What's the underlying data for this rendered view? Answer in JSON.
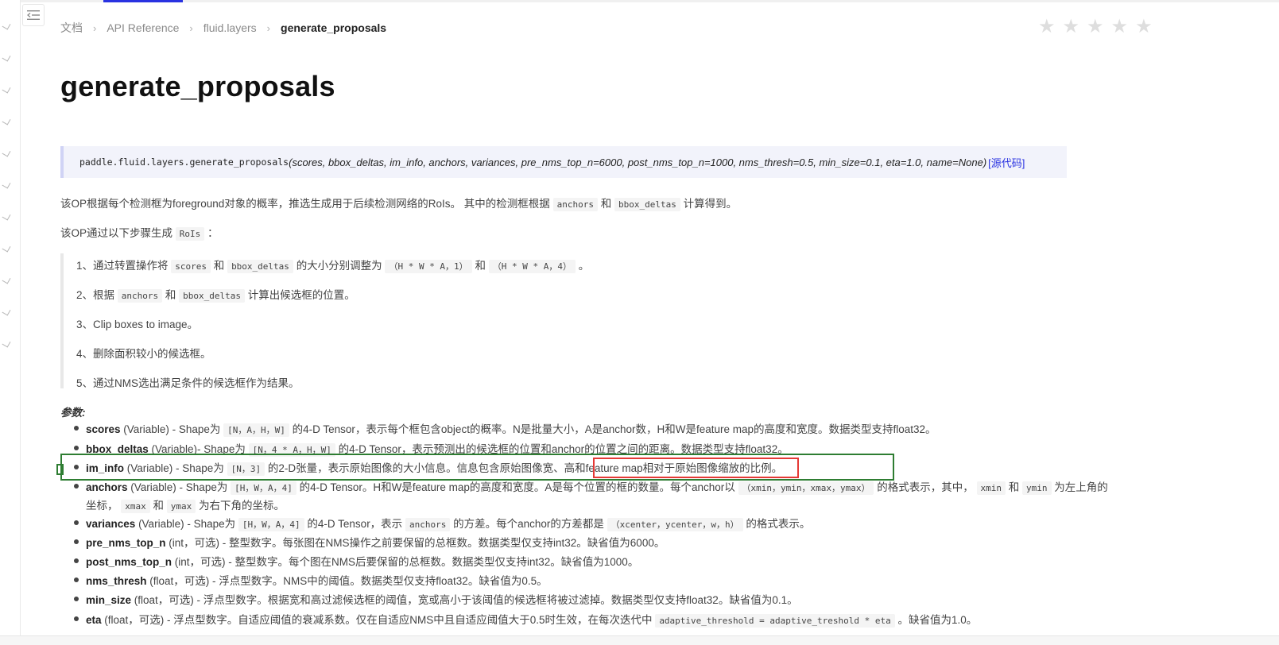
{
  "breadcrumb": {
    "items": [
      "文档",
      "API Reference",
      "fluid.layers"
    ],
    "current": "generate_proposals"
  },
  "rating": {
    "stars": 5,
    "filled": 0
  },
  "title": "generate_proposals",
  "signature": {
    "fn": "paddle.fluid.layers.generate_proposals",
    "args": "(scores, bbox_deltas, im_info, anchors, variances, pre_nms_top_n=6000, post_nms_top_n=1000, nms_thresh=0.5, min_size=0.1, eta=1.0, name=None)",
    "source_link": "[源代码]"
  },
  "intro": {
    "p1_a": "该OP根据每个检测框为foreground对象的概率，推选生成用于后续检测网络的RoIs。 其中的检测框根据",
    "p1_code1": "anchors",
    "p1_mid": "和",
    "p1_code2": "bbox_deltas",
    "p1_b": "计算得到。",
    "p2_a": "该OP通过以下步骤生成",
    "p2_code": "RoIs",
    "p2_b": "："
  },
  "steps": {
    "s1_a": "1、通过转置操作将",
    "s1_c1": "scores",
    "s1_and": "和",
    "s1_c2": "bbox_deltas",
    "s1_b": "的大小分别调整为",
    "s1_c3": "（H * W * A，1）",
    "s1_and2": "和",
    "s1_c4": "（H * W * A，4）",
    "s1_end": "。",
    "s2_a": "2、根据",
    "s2_c1": "anchors",
    "s2_and": "和",
    "s2_c2": "bbox_deltas",
    "s2_b": "计算出候选框的位置。",
    "s3": "3、Clip boxes to image。",
    "s4": "4、删除面积较小的候选框。",
    "s5": "5、通过NMS选出满足条件的候选框作为结果。"
  },
  "params_label": "参数:",
  "params": {
    "scores": {
      "name": "scores",
      "a": " (Variable) - Shape为",
      "code": "[N，A，H，W]",
      "b": "的4-D Tensor，表示每个框包含object的概率。N是批量大小，A是anchor数，H和W是feature map的高度和宽度。数据类型支持float32。"
    },
    "bbox_deltas": {
      "name": "bbox_deltas",
      "a": " (Variable)- Shape为",
      "code": "[N，4 * A，H，W]",
      "b": "的4-D Tensor，表示预测出的候选框的位置和anchor的位置之间的距离。数据类型支持float32。"
    },
    "im_info": {
      "name": "im_info",
      "a": " (Variable) - Shape为",
      "code": "[N，3]",
      "b": "的2-D张量，表示原始图像的大小信息。信息包含原始图像宽、高和feature map相对于原始图像缩放的比例。"
    },
    "anchors": {
      "name": "anchors",
      "a": " (Variable) - Shape为",
      "code": "[H，W，A，4]",
      "b": "的4-D Tensor。H和W是feature map的高度和宽度。A是每个位置的框的数量。每个anchor以",
      "code2": "（xmin，ymin，xmax，ymax）",
      "c": "的格式表示，其中，",
      "code3": "xmin",
      "and1": "和",
      "code4": "ymin",
      "d": "为左上角的",
      "line2_a": "坐标，",
      "code5": "xmax",
      "and2": "和",
      "code6": "ymax",
      "line2_b": "为右下角的坐标。"
    },
    "variances": {
      "name": "variances",
      "a": " (Variable) - Shape为",
      "code": "[H，W，A，4]",
      "b": "的4-D Tensor，表示",
      "code2": "anchors",
      "c": "的方差。每个anchor的方差都是",
      "code3": "（xcenter，ycenter，w，h）",
      "d": "的格式表示。"
    },
    "pre_nms_top_n": {
      "name": "pre_nms_top_n",
      "b": " (int，可选) - 整型数字。每张图在NMS操作之前要保留的总框数。数据类型仅支持int32。缺省值为6000。"
    },
    "post_nms_top_n": {
      "name": "post_nms_top_n",
      "b": " (int，可选) - 整型数字。每个图在NMS后要保留的总框数。数据类型仅支持int32。缺省值为1000。"
    },
    "nms_thresh": {
      "name": "nms_thresh",
      "b": " (float，可选) - 浮点型数字。NMS中的阈值。数据类型仅支持float32。缺省值为0.5。"
    },
    "min_size": {
      "name": "min_size",
      "b": " (float，可选) - 浮点型数字。根据宽和高过滤候选框的阈值，宽或高小于该阈值的候选框将被过滤掉。数据类型仅支持float32。缺省值为0.1。"
    },
    "eta": {
      "name": "eta",
      "b": " (float，可选) - 浮点型数字。自适应阈值的衰减系数。仅在自适应NMS中且自适应阈值大于0.5时生效，在每次迭代中",
      "code": "adaptive_threshold = adaptive_treshold * eta",
      "c": "。缺省值为1.0。"
    }
  },
  "colors": {
    "accent": "#2932e1",
    "highlight_green": "#2e7d32",
    "highlight_red": "#e53935"
  }
}
